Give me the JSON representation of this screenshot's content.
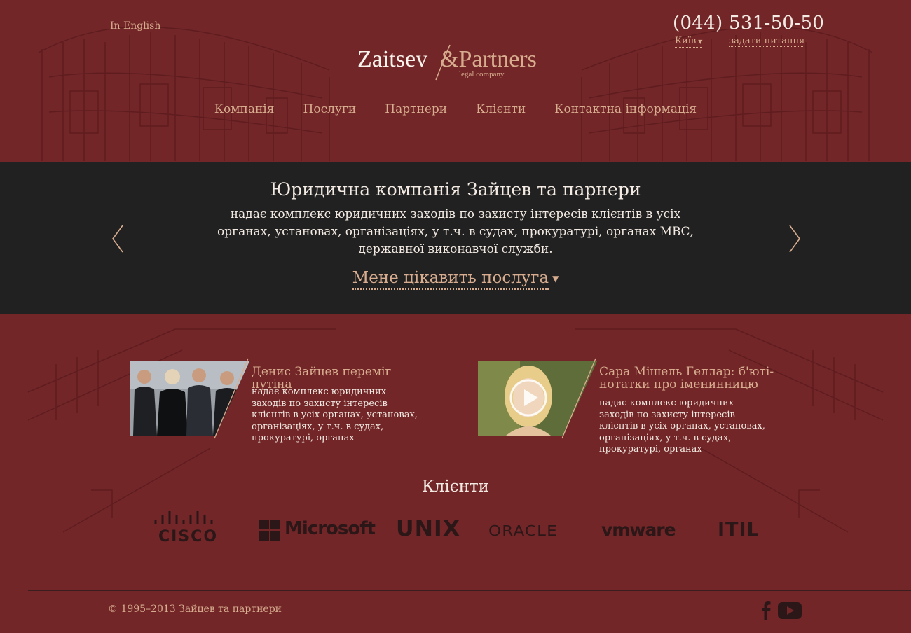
{
  "header": {
    "lang_link": "In English",
    "phone": "(044) 531-50-50",
    "city": "Київ",
    "ask_link": "задати питання",
    "logo": {
      "main": "Zaitsev",
      "ampersand_partners": "&Partners",
      "tagline": "legal company"
    }
  },
  "nav": {
    "items": [
      "Компанія",
      "Послуги",
      "Партнери",
      "Клієнти",
      "Контактна інформація"
    ]
  },
  "hero": {
    "title": "Юридична компанія Зайцев та парнери",
    "text": "надає комплекс юридичних заходів по захисту інтересів клієнтів в усіх органах, установах, організаціях, у т.ч. в судах, прокуратурі, органах МВС, державної виконавчої служби.",
    "cta": "Мене цікавить послуга"
  },
  "news": [
    {
      "headline": "Денис Зайцев переміг путіна",
      "body": "надає комплекс юридичних заходів по захисту інтересів клієнтів в усіх органах, установах, організаціях, у т.ч. в судах, прокуратурі, органах"
    },
    {
      "headline": "Сара Мішель Геллар: б'юті-нотатки про іменинницю",
      "body": "надає комплекс юридичних заходів по захисту інтересів клієнтів в усіх органах, установах, організаціях, у т.ч. в судах, прокуратурі, органах"
    }
  ],
  "clients": {
    "title": "Клієнти",
    "logos": [
      "CISCO",
      "Microsoft",
      "UNIX",
      "ORACLE",
      "vmware",
      "ITIL"
    ]
  },
  "footer": {
    "copyright": "© 1995–2013 Зайцев та партнери"
  },
  "colors": {
    "background": "#722628",
    "band": "#222121",
    "accent": "#d8ad8f",
    "light_text": "#f3ebe3"
  },
  "icons": [
    "arrow-left-icon",
    "arrow-right-icon",
    "play-icon",
    "facebook-icon",
    "youtube-icon"
  ]
}
